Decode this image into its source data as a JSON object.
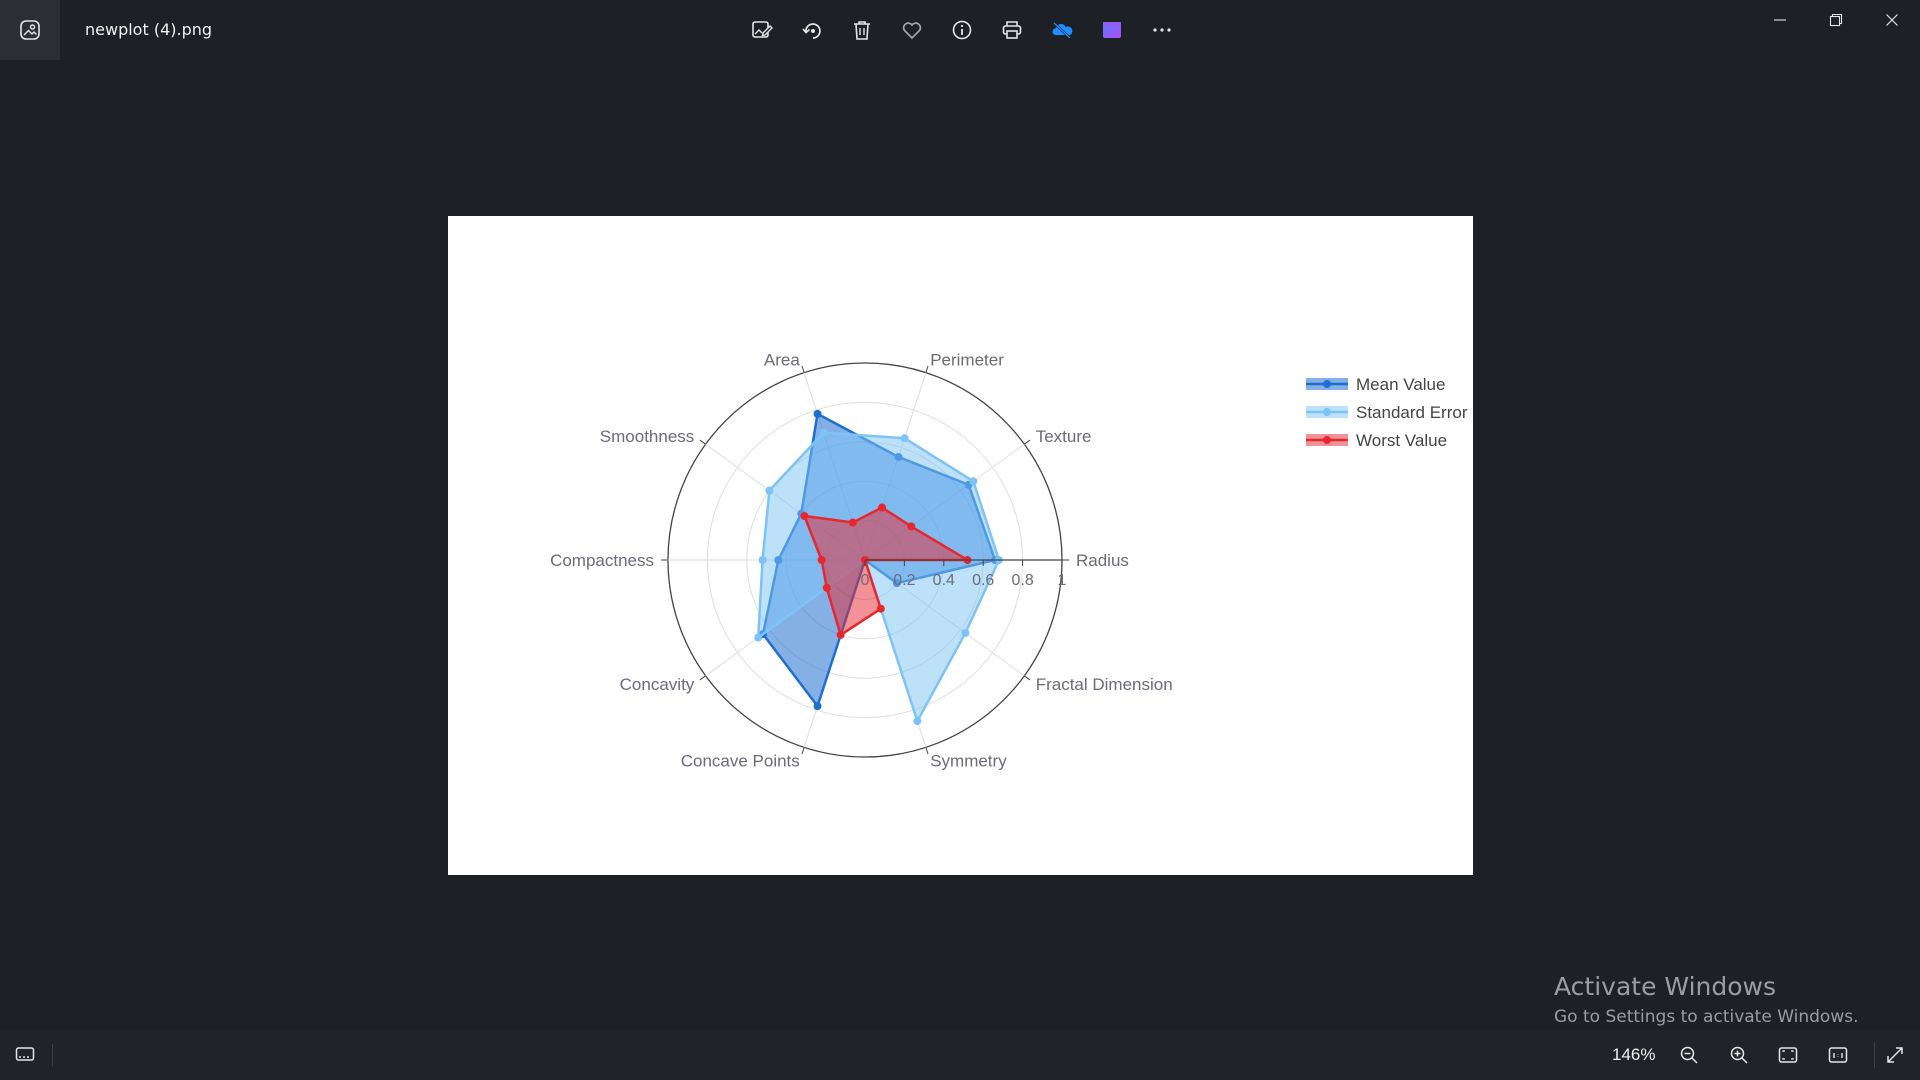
{
  "window": {
    "file_name": "newplot (4).png"
  },
  "toolbar": {
    "items": [
      {
        "name": "edit-image-button",
        "icon": "edit-image-icon"
      },
      {
        "name": "rotate-button",
        "icon": "rotate-icon"
      },
      {
        "name": "delete-button",
        "icon": "trash-icon"
      },
      {
        "name": "favorite-button",
        "icon": "heart-icon"
      },
      {
        "name": "info-button",
        "icon": "info-icon"
      },
      {
        "name": "print-button",
        "icon": "printer-icon"
      },
      {
        "name": "onedrive-button",
        "icon": "cloud-icon"
      },
      {
        "name": "clipchamp-button",
        "icon": "clapper-icon"
      },
      {
        "name": "more-button",
        "icon": "more-icon"
      }
    ]
  },
  "colors": {
    "mean": "#1f6fd1",
    "standard_error": "#7ec3f5",
    "worst": "#e8262e",
    "background": "#1d2024"
  },
  "chart_data": {
    "type": "radar",
    "axes": [
      "Radius",
      "Texture",
      "Perimeter",
      "Area",
      "Smoothness",
      "Compactness",
      "Concavity",
      "Concave Points",
      "Symmetry",
      "Fractal Dimension"
    ],
    "radial_ticks": [
      "0",
      "0.2",
      "0.4",
      "0.6",
      "0.8",
      "1"
    ],
    "radial_range": [
      0,
      1
    ],
    "legend_position": "top-right",
    "series": [
      {
        "name": "Mean Value",
        "values": [
          0.66,
          0.65,
          0.55,
          0.78,
          0.4,
          0.44,
          0.64,
          0.78,
          0.0,
          0.2
        ]
      },
      {
        "name": "Standard Error",
        "values": [
          0.68,
          0.68,
          0.65,
          0.68,
          0.6,
          0.52,
          0.67,
          0.0,
          0.86,
          0.63
        ]
      },
      {
        "name": "Worst Value",
        "values": [
          0.52,
          0.29,
          0.28,
          0.2,
          0.38,
          0.22,
          0.24,
          0.4,
          0.26,
          0.0
        ]
      }
    ]
  },
  "watermark": {
    "title": "Activate Windows",
    "subtitle": "Go to Settings to activate Windows."
  },
  "statusbar": {
    "zoom": "146%"
  }
}
